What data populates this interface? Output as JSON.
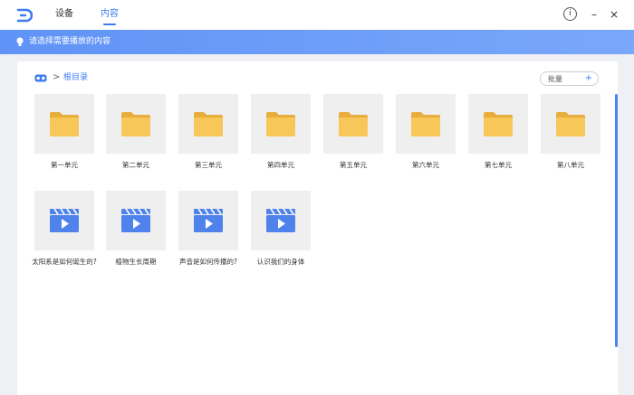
{
  "header": {
    "tabs": [
      {
        "label": "设备"
      },
      {
        "label": "内容"
      }
    ],
    "active_tab": "内容",
    "info_glyph": "i",
    "minimize_glyph": "–",
    "close_glyph": "×"
  },
  "banner": {
    "text": "请选择需要播放的内容"
  },
  "breadcrumb": {
    "separator": ">",
    "label": "根目录"
  },
  "toolbar": {
    "batch_label": "批量",
    "add_glyph": "+"
  },
  "folders": [
    {
      "label": "第一单元"
    },
    {
      "label": "第二单元"
    },
    {
      "label": "第三单元"
    },
    {
      "label": "第四单元"
    },
    {
      "label": "第五单元"
    },
    {
      "label": "第六单元"
    },
    {
      "label": "第七单元"
    },
    {
      "label": "第八单元"
    }
  ],
  "videos": [
    {
      "label": "太阳系是如何诞生的?"
    },
    {
      "label": "植物生长周期"
    },
    {
      "label": "声音是如何传播的?"
    },
    {
      "label": "认识我们的身体"
    }
  ],
  "colors": {
    "accent": "#3c7bf0",
    "folder": "#f7c759",
    "video": "#4f82ea",
    "tile_bg": "#efefef"
  },
  "icons": {
    "logo": "app-logo-icon",
    "folder": "folder-icon",
    "video": "video-clapper-icon",
    "banner": "bulb-icon",
    "breadcrumb": "vr-headset-icon"
  }
}
